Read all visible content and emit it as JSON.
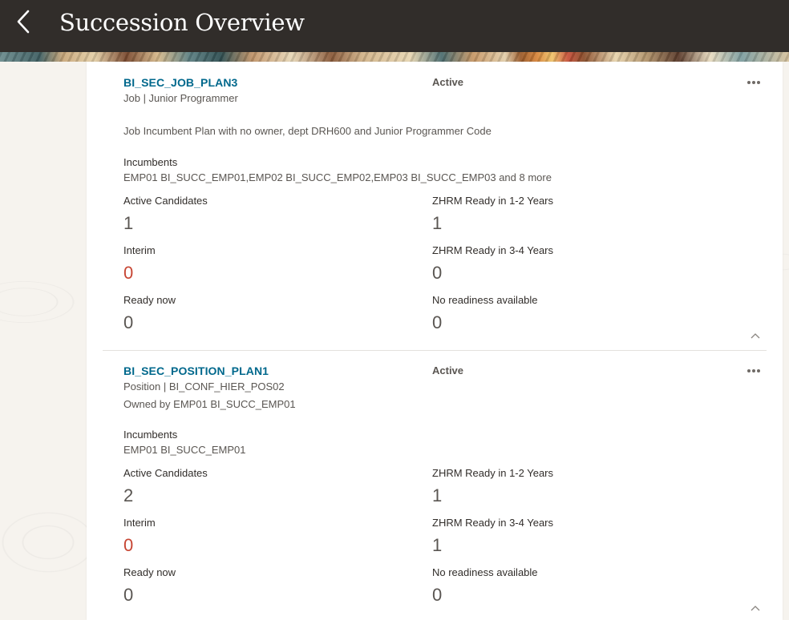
{
  "header": {
    "title": "Succession Overview",
    "back_icon": "chevron-left-icon"
  },
  "plans": [
    {
      "name": "BI_SEC_JOB_PLAN3",
      "status": "Active",
      "type_line": "Job | Junior Programmer",
      "owner_line": "",
      "description": "Job Incumbent Plan with no owner, dept DRH600 and Junior Programmer Code",
      "incumbents_label": "Incumbents",
      "incumbents_value": "EMP01 BI_SUCC_EMP01,EMP02 BI_SUCC_EMP02,EMP03 BI_SUCC_EMP03 and 8 more",
      "metrics": {
        "active_candidates_label": "Active Candidates",
        "active_candidates_value": "1",
        "ready_1_2_label": "ZHRM Ready in 1-2 Years",
        "ready_1_2_value": "1",
        "interim_label": "Interim",
        "interim_value": "0",
        "ready_3_4_label": "ZHRM Ready in 3-4 Years",
        "ready_3_4_value": "0",
        "ready_now_label": "Ready now",
        "ready_now_value": "0",
        "no_readiness_label": "No readiness available",
        "no_readiness_value": "0"
      }
    },
    {
      "name": "BI_SEC_POSITION_PLAN1",
      "status": "Active",
      "type_line": "Position | BI_CONF_HIER_POS02",
      "owner_line": "Owned by EMP01 BI_SUCC_EMP01",
      "description": "",
      "incumbents_label": "Incumbents",
      "incumbents_value": "EMP01 BI_SUCC_EMP01",
      "metrics": {
        "active_candidates_label": "Active Candidates",
        "active_candidates_value": "2",
        "ready_1_2_label": "ZHRM Ready in 1-2 Years",
        "ready_1_2_value": "1",
        "interim_label": "Interim",
        "interim_value": "0",
        "ready_3_4_label": "ZHRM Ready in 3-4 Years",
        "ready_3_4_value": "1",
        "ready_now_label": "Ready now",
        "ready_now_value": "0",
        "no_readiness_label": "No readiness available",
        "no_readiness_value": "0"
      }
    }
  ],
  "colors": {
    "header_bg": "#312d2a",
    "link": "#00688c",
    "interim_value": "#c74634"
  }
}
